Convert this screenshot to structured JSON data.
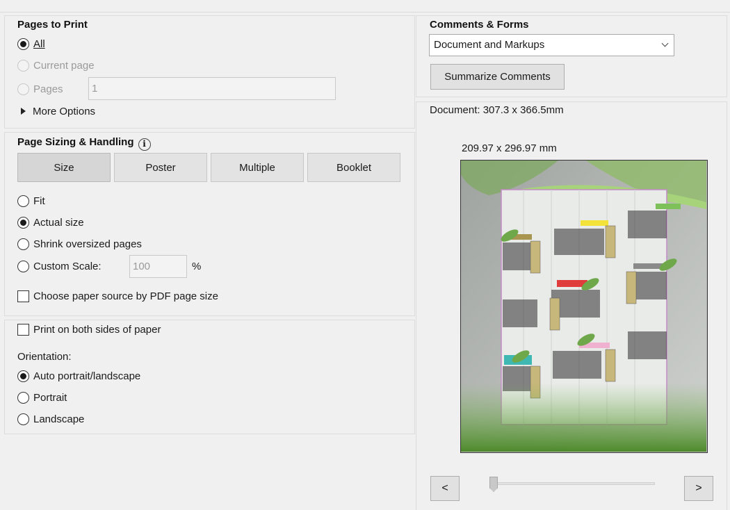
{
  "pages_to_print": {
    "heading": "Pages to Print",
    "all_label": "All",
    "current_label": "Current page",
    "pages_label": "Pages",
    "pages_value": "1",
    "more_options": "More Options"
  },
  "sizing": {
    "heading": "Page Sizing & Handling",
    "tabs": [
      "Size",
      "Poster",
      "Multiple",
      "Booklet"
    ],
    "fit": "Fit",
    "actual": "Actual size",
    "shrink": "Shrink oversized pages",
    "custom": "Custom Scale:",
    "custom_value": "100",
    "percent": "%",
    "paper_source": "Choose paper source by PDF page size"
  },
  "print_both_sides": "Print on both sides of paper",
  "orientation": {
    "label": "Orientation:",
    "auto": "Auto portrait/landscape",
    "portrait": "Portrait",
    "landscape": "Landscape"
  },
  "comments": {
    "heading": "Comments & Forms",
    "selected": "Document and Markups",
    "summarize": "Summarize Comments"
  },
  "preview": {
    "document_size": "Document: 307.3 x 366.5mm",
    "paper_size": "209.97 x 296.97 mm",
    "prev": "<",
    "next": ">",
    "page_position_fraction": 0.0
  },
  "colors": {
    "accent": "#0078d7",
    "leaf_green": "#6ea84a",
    "label_yellow": "#ffe600"
  }
}
